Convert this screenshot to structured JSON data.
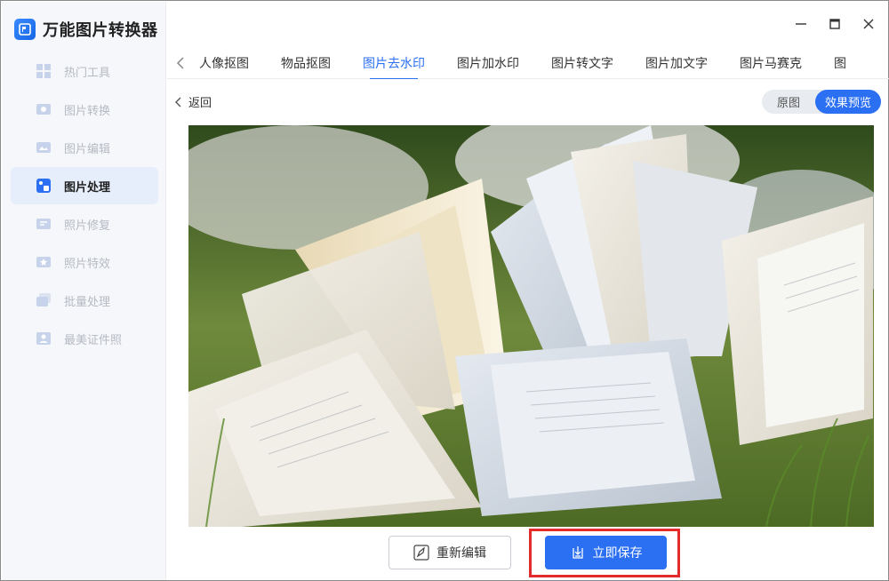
{
  "app": {
    "title": "万能图片转换器",
    "accent": "#2b6ff2"
  },
  "sidebar": {
    "items": [
      {
        "label": "热门工具",
        "icon": "grid-icon",
        "active": false
      },
      {
        "label": "图片转换",
        "icon": "image-convert-icon",
        "active": false
      },
      {
        "label": "图片编辑",
        "icon": "image-edit-icon",
        "active": false
      },
      {
        "label": "图片处理",
        "icon": "image-process-icon",
        "active": true
      },
      {
        "label": "照片修复",
        "icon": "photo-repair-icon",
        "active": false
      },
      {
        "label": "照片特效",
        "icon": "photo-effects-icon",
        "active": false
      },
      {
        "label": "批量处理",
        "icon": "batch-icon",
        "active": false
      },
      {
        "label": "最美证件照",
        "icon": "id-photo-icon",
        "active": false
      }
    ]
  },
  "tabs": [
    {
      "label": "人像抠图"
    },
    {
      "label": "物品抠图"
    },
    {
      "label": "图片去水印",
      "active": true
    },
    {
      "label": "图片加水印"
    },
    {
      "label": "图片转文字"
    },
    {
      "label": "图片加文字"
    },
    {
      "label": "图片马赛克"
    },
    {
      "label": "图"
    }
  ],
  "subbar": {
    "back_label": "返回",
    "toggle_original": "原图",
    "toggle_preview": "效果预览"
  },
  "actions": {
    "reedit_label": "重新编辑",
    "save_label": "立即保存"
  }
}
